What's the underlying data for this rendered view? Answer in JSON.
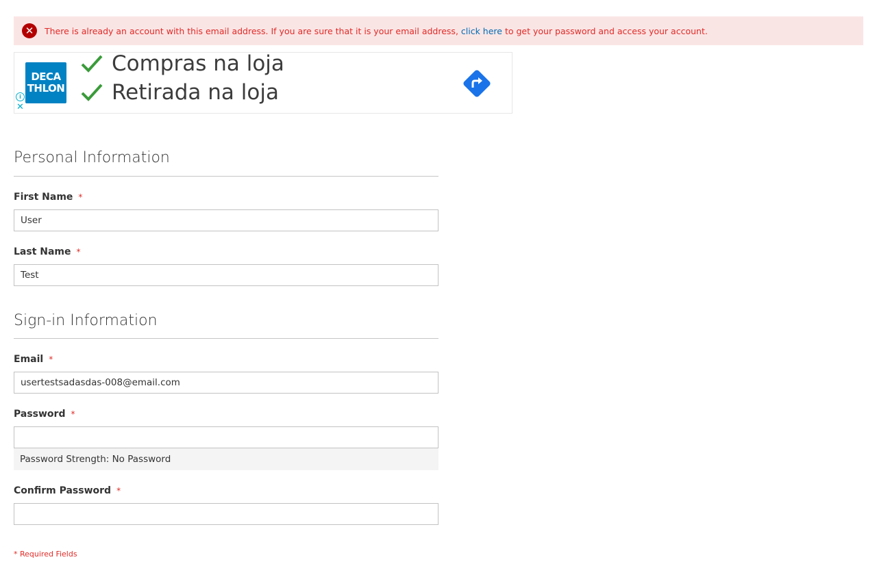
{
  "error": {
    "text_before": "There is already an account with this email address. If you are sure that it is your email address, ",
    "link": "click here",
    "text_after": " to get your password and access your account."
  },
  "ad": {
    "logo_line1": "DECA",
    "logo_line2": "THLON",
    "line1": "Compras na loja",
    "line2": "Retirada na loja",
    "info_icon": "info-icon",
    "close_icon": "close-icon",
    "accent": "#0082c3",
    "directions_color": "#1a73e8"
  },
  "personal": {
    "legend": "Personal Information",
    "first_name_label": "First Name",
    "first_name_value": "User",
    "last_name_label": "Last Name",
    "last_name_value": "Test"
  },
  "signin": {
    "legend": "Sign-in Information",
    "email_label": "Email",
    "email_value": "usertestsadasdas-008@email.com",
    "password_label": "Password",
    "password_value": "",
    "strength_text": "Password Strength: No Password",
    "confirm_label": "Confirm Password",
    "confirm_value": ""
  },
  "required_marker": "*",
  "required_note": "* Required Fields",
  "colors": {
    "error_bg": "#fae5e5",
    "error_text": "#e02b27",
    "link": "#006bb4"
  }
}
